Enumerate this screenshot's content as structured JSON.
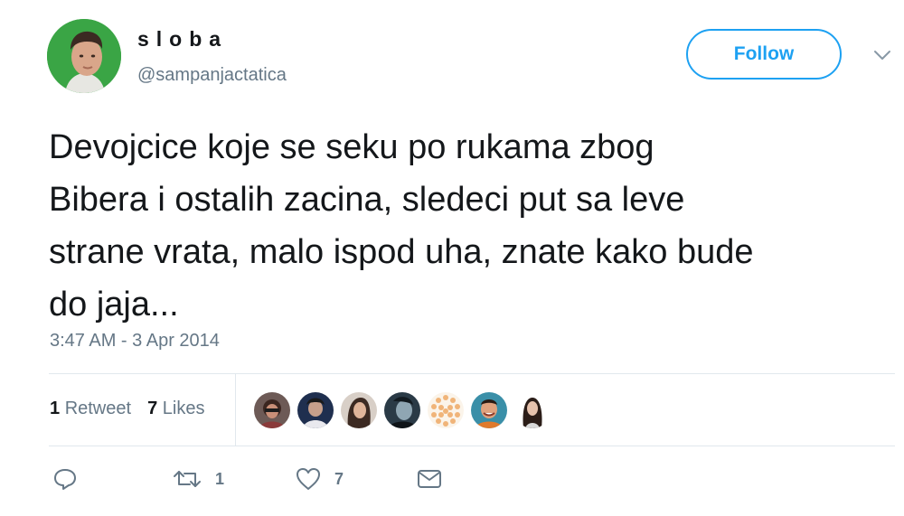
{
  "author": {
    "display_name": "sloba",
    "username": "@sampanjactatica"
  },
  "follow_label": "Follow",
  "tweet": {
    "lines": [
      "Devojcice koje se seku po rukama zbog",
      "Bibera i ostalih zacina, sledeci put sa leve",
      "strane vrata, malo ispod uha, znate kako bude",
      "do jaja..."
    ],
    "timestamp": "3:47 AM - 3 Apr 2014"
  },
  "stats": {
    "retweets_count": "1",
    "retweets_label": "Retweet",
    "likes_count": "7",
    "likes_label": "Likes"
  },
  "actions": {
    "reply_count": "",
    "retweet_count": "1",
    "like_count": "7"
  },
  "colors": {
    "accent": "#1da1f2",
    "secondary_text": "#657786",
    "divider": "#e1e8ed"
  }
}
